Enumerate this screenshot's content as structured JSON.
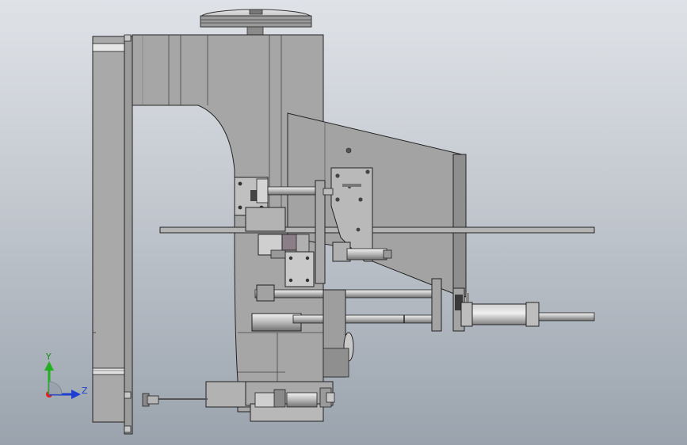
{
  "viewport": {
    "background_top": "#dfe3e8",
    "background_bottom": "#9aa3ad"
  },
  "triad": {
    "y_label": "Y",
    "z_label": "Z",
    "x_color": "#e02020",
    "y_color": "#22b022",
    "z_color": "#1f3fd0"
  }
}
